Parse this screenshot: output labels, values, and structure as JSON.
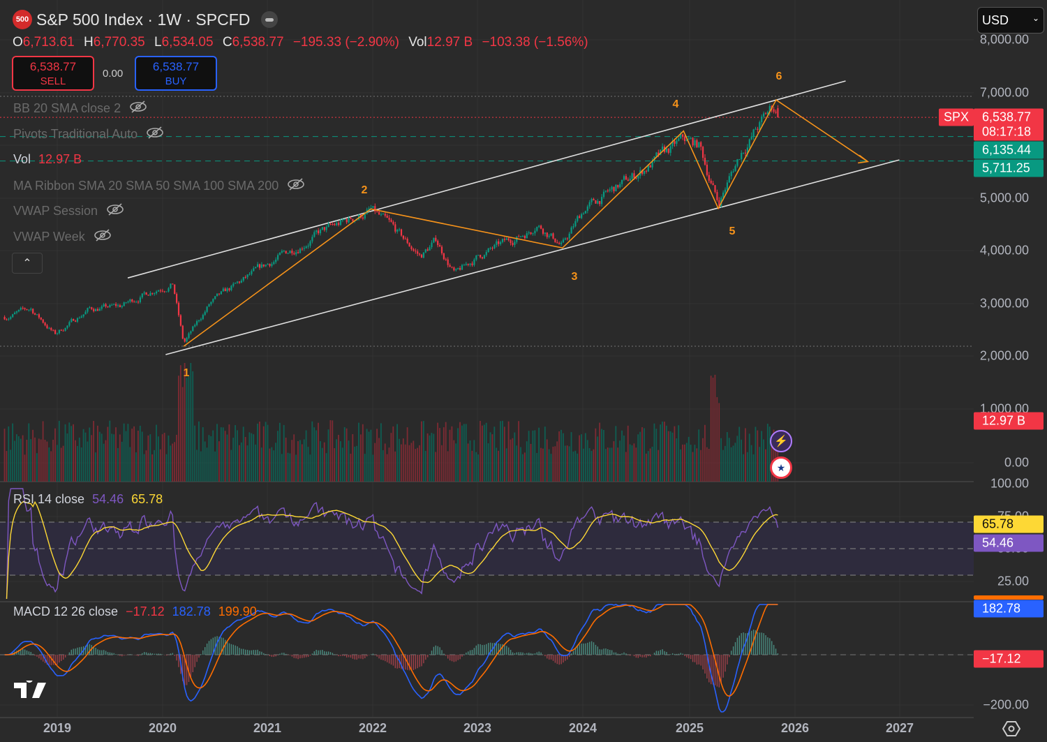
{
  "header": {
    "logo_text": "500",
    "title": "S&P 500 Index · 1W · SPCFD",
    "ohlc": {
      "o_label": "O",
      "o": "6,713.61",
      "h_label": "H",
      "h": "6,770.35",
      "l_label": "L",
      "l": "6,534.05",
      "c_label": "C",
      "c": "6,538.77",
      "change": "−195.33 (−2.90%)",
      "vol_label": "Vol",
      "vol": "12.97 B",
      "vol_change": "−103.38 (−1.56%)"
    }
  },
  "trade": {
    "sell_price": "6,538.77",
    "sell_label": "SELL",
    "spread": "0.00",
    "buy_price": "6,538.77",
    "buy_label": "BUY"
  },
  "currency": "USD",
  "indicators": [
    {
      "label": "BB 20 SMA close 2",
      "hidden": true
    },
    {
      "label": "Pivots Traditional Auto",
      "hidden": true
    },
    {
      "label": "MA Ribbon SMA 20 SMA 50 SMA 100 SMA 200",
      "hidden": true
    },
    {
      "label": "VWAP Session",
      "hidden": true
    },
    {
      "label": "VWAP Week",
      "hidden": true
    }
  ],
  "vol_legend": {
    "label": "Vol",
    "value": "12.97 B"
  },
  "rsi_legend": {
    "label": "RSI 14 close",
    "rsi": "54.46",
    "signal": "65.78"
  },
  "macd_legend": {
    "label": "MACD 12 26 close",
    "hist": "−17.12",
    "macd": "182.78",
    "signal": "199.90"
  },
  "price_axis": [
    "8,000.00",
    "7,000.00",
    "5,000.00",
    "4,000.00",
    "3,000.00",
    "2,000.00",
    "1,000.00",
    "0.00",
    "100.00",
    "75.00",
    "50.00",
    "25.00",
    "−200.00"
  ],
  "badges": {
    "symbol": "SPX",
    "last": "6,538.77",
    "countdown": "08:17:18",
    "level1": "6,135.44",
    "level2": "5,711.25",
    "volume": "12.97 B",
    "rsi_signal": "65.78",
    "rsi": "54.46",
    "macd": "182.78",
    "hist": "−17.12"
  },
  "time_axis": [
    "2019",
    "2020",
    "2021",
    "2022",
    "2023",
    "2024",
    "2025",
    "2026",
    "2027"
  ],
  "wave_labels": [
    "1",
    "2",
    "3",
    "4",
    "5",
    "6"
  ],
  "colors": {
    "up": "#089981",
    "down": "#f23645",
    "wave": "#f7931a",
    "rsi": "#7e57c2",
    "rsi_signal": "#fdd835",
    "macd": "#2962ff",
    "macd_signal": "#ff6d00"
  },
  "chart_data": {
    "type": "candlestick",
    "interval": "1W",
    "price_path": [
      [
        2018.5,
        2750
      ],
      [
        2018.75,
        2900
      ],
      [
        2018.98,
        2420
      ],
      [
        2019.3,
        2900
      ],
      [
        2019.6,
        2950
      ],
      [
        2019.95,
        3300
      ],
      [
        2020.1,
        3380
      ],
      [
        2020.2,
        2240
      ],
      [
        2020.45,
        3000
      ],
      [
        2020.7,
        3350
      ],
      [
        2021.0,
        3750
      ],
      [
        2021.5,
        4350
      ],
      [
        2021.98,
        4770
      ],
      [
        2022.2,
        4400
      ],
      [
        2022.45,
        3900
      ],
      [
        2022.6,
        4200
      ],
      [
        2022.78,
        3550
      ],
      [
        2023.0,
        3900
      ],
      [
        2023.5,
        4400
      ],
      [
        2023.55,
        4560
      ],
      [
        2023.8,
        4100
      ],
      [
        2024.0,
        4780
      ],
      [
        2024.5,
        5450
      ],
      [
        2024.95,
        6100
      ],
      [
        2025.1,
        6000
      ],
      [
        2025.28,
        4900
      ],
      [
        2025.5,
        5900
      ],
      [
        2025.8,
        6750
      ],
      [
        2025.85,
        6538.77
      ]
    ],
    "waves": [
      [
        2020.2,
        2190
      ],
      [
        2021.98,
        4800
      ],
      [
        2023.8,
        4060
      ],
      [
        2024.95,
        6280
      ],
      [
        2025.28,
        4810
      ],
      [
        2025.83,
        6870
      ],
      [
        2026.7,
        5700
      ]
    ],
    "channel_upper": [
      [
        2019.67,
        3490
      ],
      [
        2026.49,
        7230
      ]
    ],
    "channel_lower": [
      [
        2020.03,
        2034
      ],
      [
        2027.0,
        5731
      ]
    ],
    "levels": [
      6538.77,
      6135.44,
      5711.25
    ],
    "price_range": [
      0,
      8000
    ],
    "rsi_bands": [
      30,
      50,
      70
    ]
  }
}
